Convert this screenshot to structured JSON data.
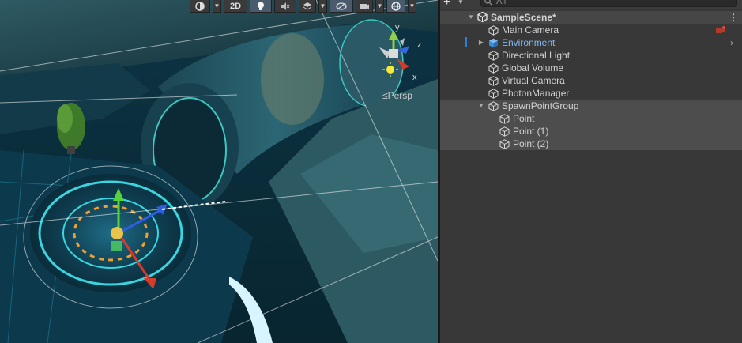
{
  "scene_toolbar": {
    "draw_mode_icon": "shading-mode-icon",
    "view_2d_label": "2D",
    "lighting_icon": "lightbulb-icon",
    "audio_icon": "audio-mute-icon",
    "effects_icon": "effects-layers-icon",
    "visibility_icon": "hidden-eye-icon",
    "camera_icon": "scene-camera-icon",
    "gizmos_icon": "gizmo-sphere-icon"
  },
  "gizmo": {
    "y_label": "y",
    "z_label": "z",
    "x_label": "x",
    "projection_label": "Persp"
  },
  "hierarchy": {
    "add_label": "+",
    "search_placeholder": "All",
    "scene_name": "SampleScene*",
    "scene_menu": "⋮",
    "items": [
      {
        "label": "Main Camera",
        "prefab": false
      },
      {
        "label": "Environment",
        "prefab": true
      },
      {
        "label": "Directional Light",
        "prefab": false
      },
      {
        "label": "Global Volume",
        "prefab": false
      },
      {
        "label": "Virtual Camera",
        "prefab": false
      },
      {
        "label": "PhotonManager",
        "prefab": false
      },
      {
        "label": "SpawnPointGroup",
        "prefab": false
      },
      {
        "label": "Point",
        "prefab": false
      },
      {
        "label": "Point (1)",
        "prefab": false
      },
      {
        "label": "Point (2)",
        "prefab": false
      }
    ]
  },
  "colors": {
    "prefab_blue": "#7dbbf5",
    "selection_accent": "#2f7fd0",
    "panel_bg": "#383838"
  }
}
